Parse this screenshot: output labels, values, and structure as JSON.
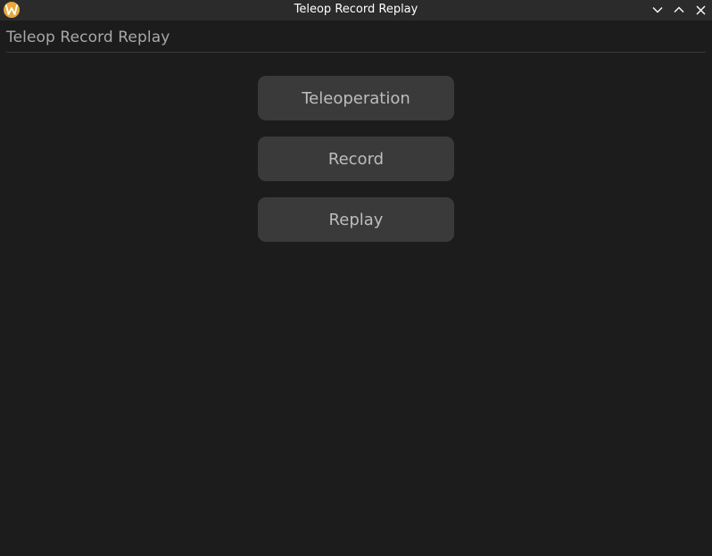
{
  "window": {
    "title": "Teleop Record Replay",
    "icon": "app-logo-icon",
    "controls": [
      "minimize-icon",
      "maximize-icon",
      "close-icon"
    ]
  },
  "app": {
    "heading": "Teleop Record Replay"
  },
  "buttons": {
    "teleoperation": "Teleoperation",
    "record": "Record",
    "replay": "Replay"
  },
  "colors": {
    "background": "#1c1c1c",
    "titlebar": "#2b2b2b",
    "button": "#3a3a3a",
    "button_text": "#bdbdbd",
    "heading_text": "#a8a8a8",
    "icon_accent": "#e8a83a"
  }
}
